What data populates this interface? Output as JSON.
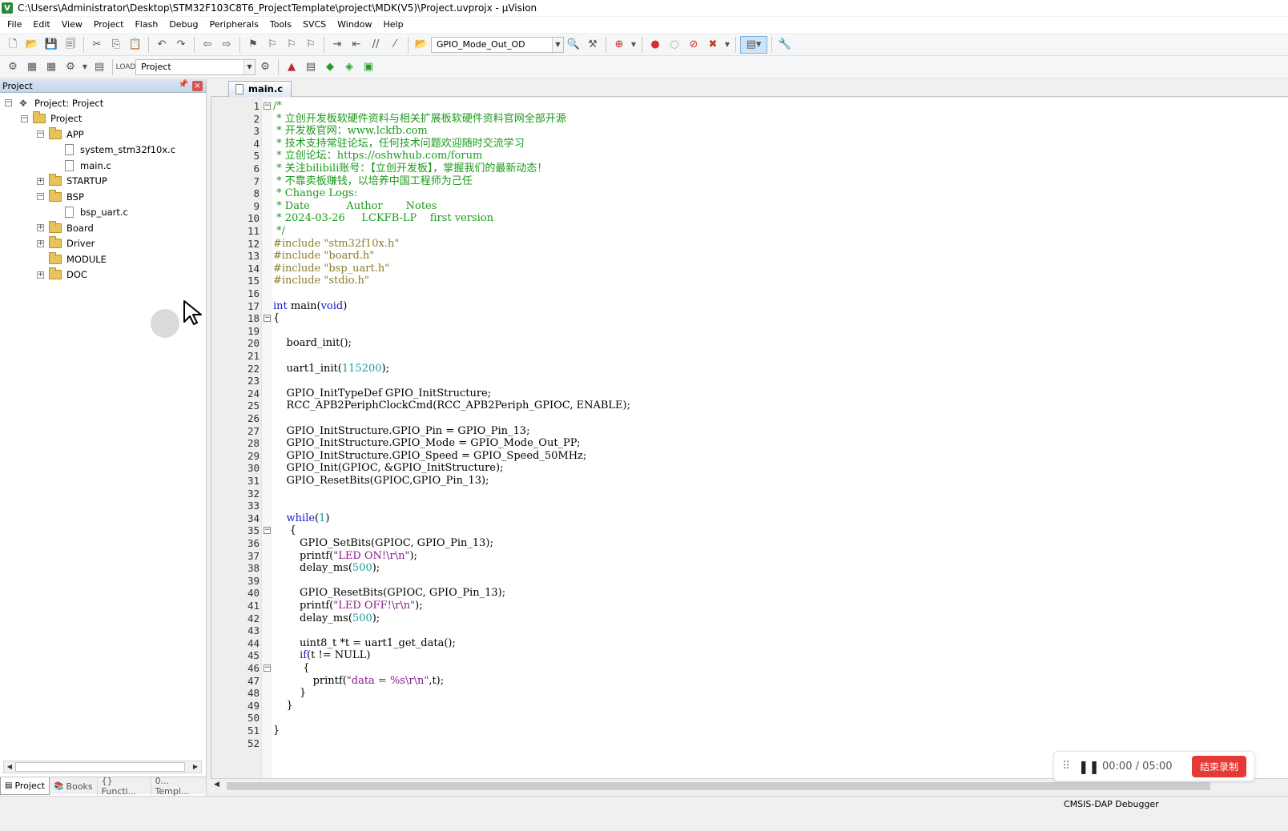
{
  "window": {
    "title": "C:\\Users\\Administrator\\Desktop\\STM32F103C8T6_ProjectTemplate\\project\\MDK(V5)\\Project.uvprojx - µVision"
  },
  "menu": [
    "File",
    "Edit",
    "View",
    "Project",
    "Flash",
    "Debug",
    "Peripherals",
    "Tools",
    "SVCS",
    "Window",
    "Help"
  ],
  "toolbar1": {
    "find_combo": "GPIO_Mode_Out_OD"
  },
  "toolbar2": {
    "target_combo": "Project"
  },
  "project_panel": {
    "header": "Project",
    "tree": [
      {
        "label": "Project: Project",
        "depth": 0,
        "expander": "-",
        "icon": "project-root"
      },
      {
        "label": "Project",
        "depth": 1,
        "expander": "-",
        "icon": "target-folder"
      },
      {
        "label": "APP",
        "depth": 2,
        "expander": "-",
        "icon": "folder"
      },
      {
        "label": "system_stm32f10x.c",
        "depth": 3,
        "expander": "",
        "icon": "file"
      },
      {
        "label": "main.c",
        "depth": 3,
        "expander": "",
        "icon": "file"
      },
      {
        "label": "STARTUP",
        "depth": 2,
        "expander": "+",
        "icon": "folder"
      },
      {
        "label": "BSP",
        "depth": 2,
        "expander": "-",
        "icon": "folder"
      },
      {
        "label": "bsp_uart.c",
        "depth": 3,
        "expander": "",
        "icon": "file"
      },
      {
        "label": "Board",
        "depth": 2,
        "expander": "+",
        "icon": "folder"
      },
      {
        "label": "Driver",
        "depth": 2,
        "expander": "+",
        "icon": "folder"
      },
      {
        "label": "MODULE",
        "depth": 2,
        "expander": "",
        "icon": "folder"
      },
      {
        "label": "DOC",
        "depth": 2,
        "expander": "+",
        "icon": "folder"
      }
    ],
    "bottom_tabs": [
      "Project",
      "Books",
      "{} Functi...",
      "0... Templ..."
    ]
  },
  "editor": {
    "tab_label": "main.c",
    "lines": [
      {
        "n": "1",
        "fold": "-",
        "cls": "c-comment",
        "text": "/*"
      },
      {
        "n": "2",
        "fold": "",
        "cls": "c-comment",
        "text": " * 立创开发板软硬件资料与相关扩展板软硬件资料官网全部开源"
      },
      {
        "n": "3",
        "fold": "",
        "cls": "c-comment",
        "text": " * 开发板官网：www.lckfb.com"
      },
      {
        "n": "4",
        "fold": "",
        "cls": "c-comment",
        "text": " * 技术支持常驻论坛，任何技术问题欢迎随时交流学习"
      },
      {
        "n": "5",
        "fold": "",
        "cls": "c-comment",
        "text": " * 立创论坛：https://oshwhub.com/forum"
      },
      {
        "n": "6",
        "fold": "",
        "cls": "c-comment",
        "text": " * 关注bilibili账号：【立创开发板】，掌握我们的最新动态！"
      },
      {
        "n": "7",
        "fold": "",
        "cls": "c-comment",
        "text": " * 不靠卖板赚钱，以培养中国工程师为己任"
      },
      {
        "n": "8",
        "fold": "",
        "cls": "c-comment",
        "text": " * Change Logs:"
      },
      {
        "n": "9",
        "fold": "",
        "cls": "c-comment",
        "text": " * Date           Author       Notes"
      },
      {
        "n": "10",
        "fold": "",
        "cls": "c-comment",
        "text": " * 2024-03-26     LCKFB-LP    first version"
      },
      {
        "n": "11",
        "fold": "",
        "cls": "c-comment",
        "text": " */"
      },
      {
        "n": "12",
        "fold": "",
        "cls": "c-prepro",
        "text": "#include \"stm32f10x.h\""
      },
      {
        "n": "13",
        "fold": "",
        "cls": "c-prepro",
        "text": "#include \"board.h\""
      },
      {
        "n": "14",
        "fold": "",
        "cls": "c-prepro",
        "text": "#include \"bsp_uart.h\""
      },
      {
        "n": "15",
        "fold": "",
        "cls": "c-prepro",
        "text": "#include \"stdio.h\""
      },
      {
        "n": "16",
        "fold": "",
        "cls": "",
        "text": ""
      },
      {
        "n": "17",
        "fold": "",
        "cls": "",
        "text": "int main(void)"
      },
      {
        "n": "18",
        "fold": "-",
        "cls": "",
        "text": "{"
      },
      {
        "n": "19",
        "fold": "",
        "cls": "",
        "text": ""
      },
      {
        "n": "20",
        "fold": "",
        "cls": "",
        "text": "    board_init();"
      },
      {
        "n": "21",
        "fold": "",
        "cls": "",
        "text": ""
      },
      {
        "n": "22",
        "fold": "",
        "cls": "",
        "text": "    uart1_init(115200);"
      },
      {
        "n": "23",
        "fold": "",
        "cls": "",
        "text": ""
      },
      {
        "n": "24",
        "fold": "",
        "cls": "",
        "text": "    GPIO_InitTypeDef GPIO_InitStructure;"
      },
      {
        "n": "25",
        "fold": "",
        "cls": "",
        "text": "    RCC_APB2PeriphClockCmd(RCC_APB2Periph_GPIOC, ENABLE);"
      },
      {
        "n": "26",
        "fold": "",
        "cls": "",
        "text": ""
      },
      {
        "n": "27",
        "fold": "",
        "cls": "",
        "text": "    GPIO_InitStructure.GPIO_Pin = GPIO_Pin_13;"
      },
      {
        "n": "28",
        "fold": "",
        "cls": "",
        "text": "    GPIO_InitStructure.GPIO_Mode = GPIO_Mode_Out_PP;"
      },
      {
        "n": "29",
        "fold": "",
        "cls": "",
        "text": "    GPIO_InitStructure.GPIO_Speed = GPIO_Speed_50MHz;"
      },
      {
        "n": "30",
        "fold": "",
        "cls": "",
        "text": "    GPIO_Init(GPIOC, &GPIO_InitStructure);"
      },
      {
        "n": "31",
        "fold": "",
        "cls": "",
        "text": "    GPIO_ResetBits(GPIOC,GPIO_Pin_13);"
      },
      {
        "n": "32",
        "fold": "",
        "cls": "",
        "text": ""
      },
      {
        "n": "33",
        "fold": "",
        "cls": "",
        "text": ""
      },
      {
        "n": "34",
        "fold": "",
        "cls": "",
        "text": "    while(1)"
      },
      {
        "n": "35",
        "fold": "-",
        "cls": "",
        "text": "     {"
      },
      {
        "n": "36",
        "fold": "",
        "cls": "",
        "text": "        GPIO_SetBits(GPIOC, GPIO_Pin_13);"
      },
      {
        "n": "37",
        "fold": "",
        "cls": "",
        "text": "        printf(\"LED ON!\\r\\n\");"
      },
      {
        "n": "38",
        "fold": "",
        "cls": "",
        "text": "        delay_ms(500);"
      },
      {
        "n": "39",
        "fold": "",
        "cls": "",
        "text": ""
      },
      {
        "n": "40",
        "fold": "",
        "cls": "",
        "text": "        GPIO_ResetBits(GPIOC, GPIO_Pin_13);"
      },
      {
        "n": "41",
        "fold": "",
        "cls": "",
        "text": "        printf(\"LED OFF!\\r\\n\");"
      },
      {
        "n": "42",
        "fold": "",
        "cls": "",
        "text": "        delay_ms(500);"
      },
      {
        "n": "43",
        "fold": "",
        "cls": "",
        "text": ""
      },
      {
        "n": "44",
        "fold": "",
        "cls": "",
        "text": "        uint8_t *t = uart1_get_data();"
      },
      {
        "n": "45",
        "fold": "",
        "cls": "",
        "text": "        if(t != NULL)"
      },
      {
        "n": "46",
        "fold": "-",
        "cls": "",
        "text": "         {"
      },
      {
        "n": "47",
        "fold": "",
        "cls": "",
        "text": "            printf(\"data = %s\\r\\n\",t);"
      },
      {
        "n": "48",
        "fold": "",
        "cls": "",
        "text": "        }"
      },
      {
        "n": "49",
        "fold": "",
        "cls": "",
        "text": "    }"
      },
      {
        "n": "50",
        "fold": "",
        "cls": "",
        "text": ""
      },
      {
        "n": "51",
        "fold": "",
        "cls": "",
        "text": "}"
      },
      {
        "n": "52",
        "fold": "",
        "cls": "",
        "text": ""
      }
    ]
  },
  "recorder": {
    "time": "00:00 / 05:00",
    "stop_label": "结束录制"
  },
  "status": {
    "debugger": "CMSIS-DAP Debugger"
  },
  "colors": {
    "comment": "#1a9b1a",
    "preprocessor": "#8a7b2a",
    "keyword": "#1515c8",
    "string": "#8b1a8b",
    "number": "#1a9b9b",
    "stop_button": "#e53935"
  }
}
